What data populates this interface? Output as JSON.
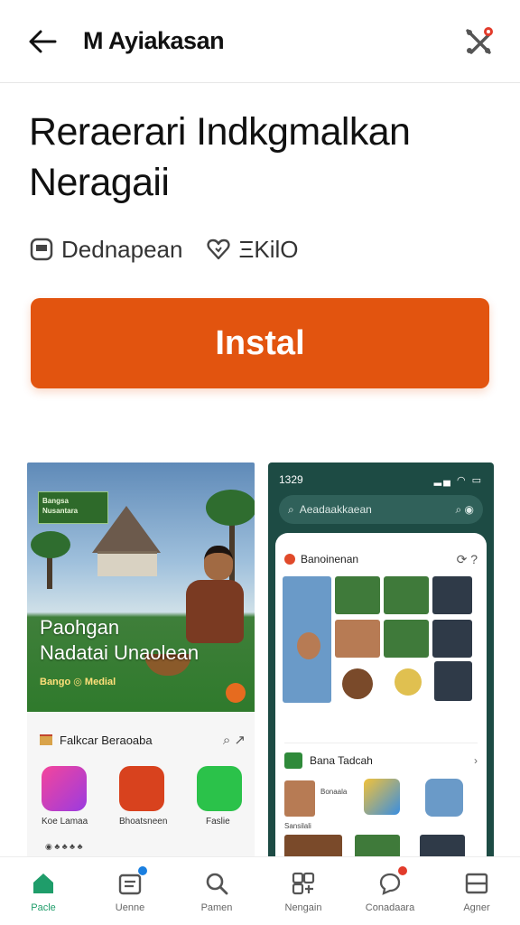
{
  "header": {
    "title": "M Ayiakasan"
  },
  "app": {
    "title": "Reraerari Indkgmalkan Neragaii",
    "developer": "Dednapean",
    "rating_text": "ΞKilO",
    "install_label": "Instal"
  },
  "screenshot1": {
    "badge": "Bangsa Nusantara",
    "headline1": "Paohgan",
    "headline2": "Nadatai Unaolean",
    "subline": "Bango ◎ Medial",
    "section_title": "Falkcar Beraoaba",
    "tiles": [
      "Koe Lamaa",
      "Bhoatsneen",
      "Faslie"
    ]
  },
  "screenshot2": {
    "time": "1329",
    "search_placeholder": "Aeadaakkaean",
    "card_title": "Banoinenan",
    "section_title": "Bana Tadcah",
    "section_caption": "Bonaala",
    "caption_list": "Sansilali"
  },
  "nav": {
    "items": [
      {
        "label": "Pacle",
        "icon": "home-icon"
      },
      {
        "label": "Uenne",
        "icon": "news-icon"
      },
      {
        "label": "Pamen",
        "icon": "search-icon"
      },
      {
        "label": "Nengain",
        "icon": "apps-icon"
      },
      {
        "label": "Conadaara",
        "icon": "chat-icon"
      },
      {
        "label": "Agner",
        "icon": "window-icon"
      }
    ]
  },
  "colors": {
    "accent": "#e2540f",
    "active_nav": "#1f9d6a",
    "badge_red": "#e23b2b",
    "badge_blue": "#1a7fe0"
  }
}
